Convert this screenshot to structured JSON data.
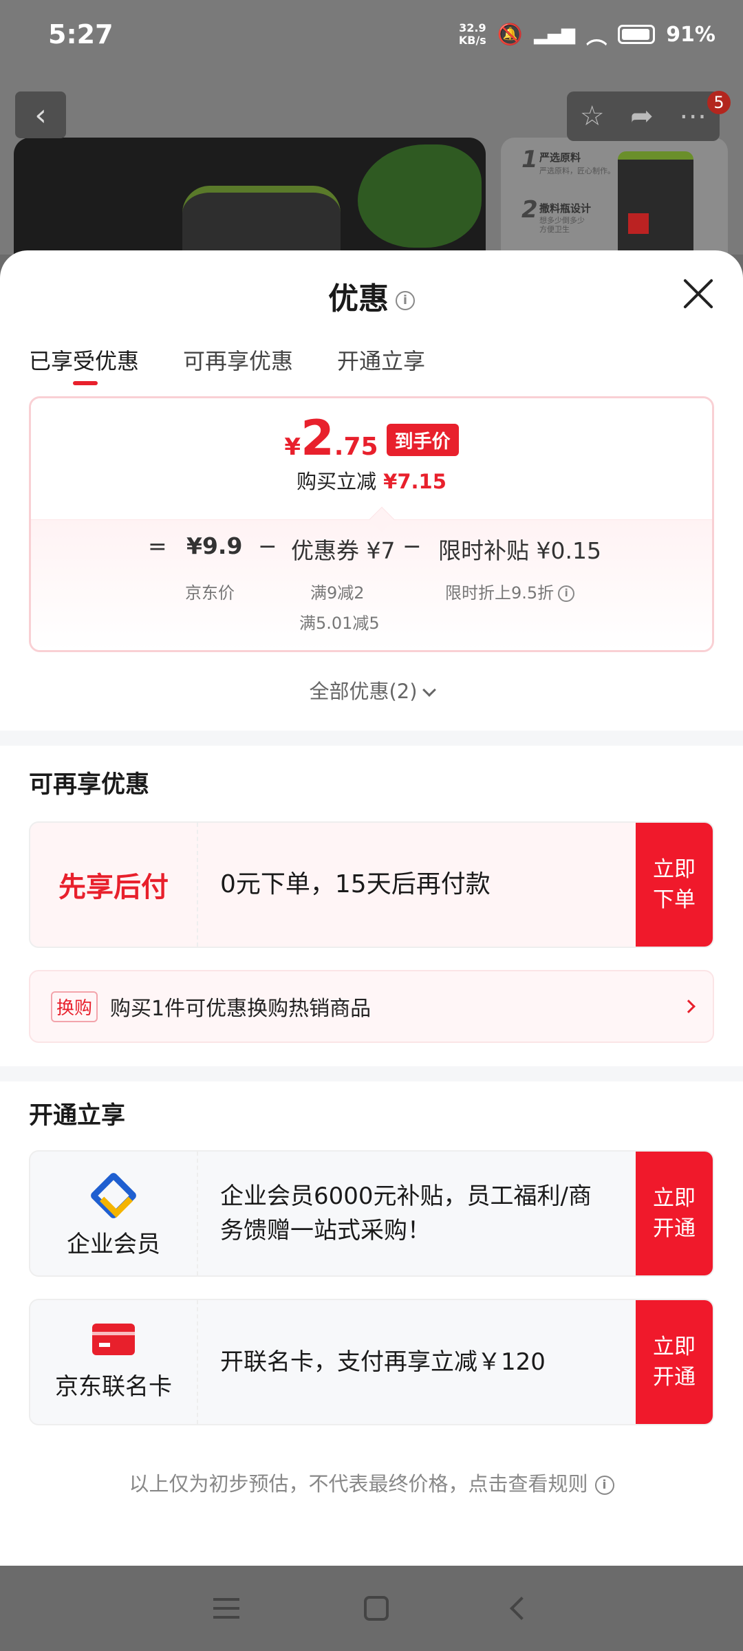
{
  "status_bar": {
    "time": "5:27",
    "net_speed_value": "32.9",
    "net_speed_unit": "KB/s",
    "battery": "91%"
  },
  "background": {
    "badge_count": "5",
    "side_card": {
      "step1_num": "1",
      "step1_title": "严选原料",
      "step1_sub": "严选原料，匠心制作。",
      "step2_num": "2",
      "step2_title": "撒料瓶设计",
      "step2_sub": "想多少倒多少 方便卫生"
    }
  },
  "sheet": {
    "title": "优惠",
    "info_glyph": "i",
    "tabs": [
      {
        "label": "已享受优惠"
      },
      {
        "label": "可再享优惠"
      },
      {
        "label": "开通立享"
      }
    ],
    "price": {
      "yen": "¥",
      "integer": "2",
      "decimal": ".75",
      "tag": "到手价",
      "sub_label": "购买立减",
      "sub_value": "¥7.15"
    },
    "formula": {
      "eq": "=",
      "jd_price": "¥9.9",
      "minus1": "−",
      "coupon": "优惠券 ¥7",
      "minus2": "−",
      "subsidy": "限时补贴 ¥0.15",
      "jd_price_note": "京东价",
      "coupon_note1": "满9减2",
      "coupon_note2": "满5.01减5",
      "subsidy_note": "限时折上9.5折"
    },
    "all_discounts": "全部优惠(2)",
    "section_more": {
      "title": "可再享优惠",
      "pay_later": {
        "label": "先享后付",
        "desc": "0元下单，15天后再付款",
        "btn_line1": "立即",
        "btn_line2": "下单"
      },
      "swap": {
        "tag": "换购",
        "text": "购买1件可优惠换购热销商品"
      }
    },
    "section_open": {
      "title": "开通立享",
      "enterprise": {
        "label": "企业会员",
        "desc": "企业会员6000元补贴，员工福利/商务馈赠一站式采购！",
        "btn_line1": "立即",
        "btn_line2": "开通"
      },
      "cobrand": {
        "label": "京东联名卡",
        "desc": "开联名卡，支付再享立减￥120",
        "btn_line1": "立即",
        "btn_line2": "开通"
      }
    },
    "footnote": "以上仅为初步预估，不代表最终价格，点击查看规则"
  },
  "colors": {
    "accent_red": "#e8202c",
    "button_red": "#f0192b"
  }
}
